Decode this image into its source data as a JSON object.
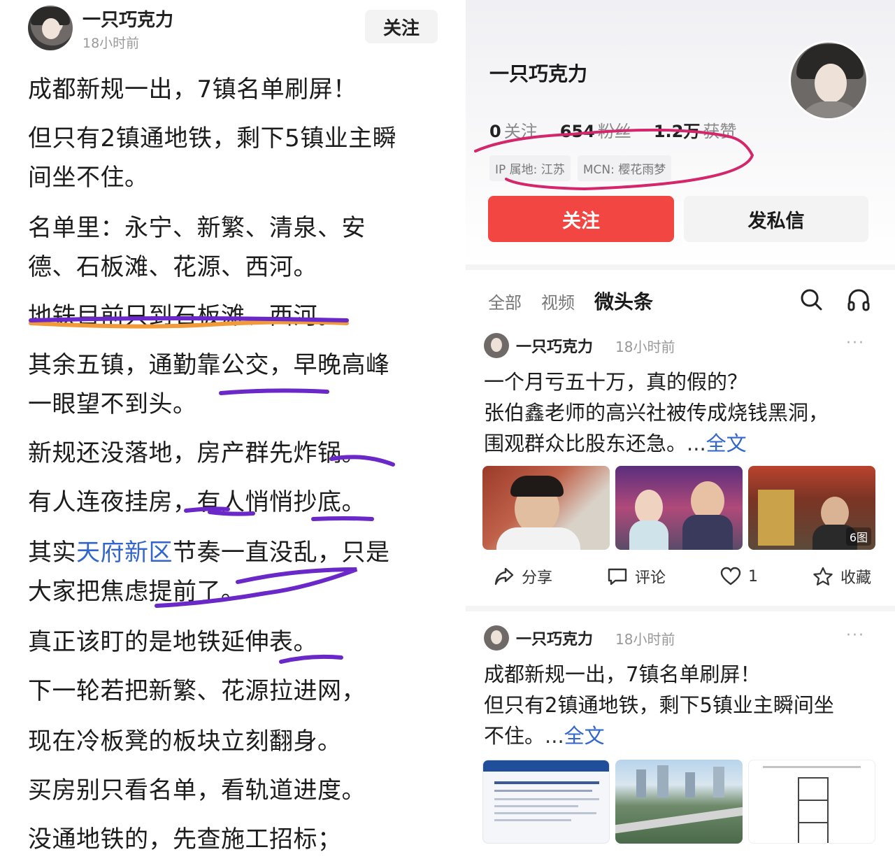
{
  "left": {
    "author": "一只巧克力",
    "time": "18小时前",
    "follow_label": "关注",
    "lines": [
      "成都新规一出，7镇名单刷屏！",
      "但只有2镇通地铁，剩下5镇业主瞬",
      "间坐不住。",
      "名单里：永宁、新繁、清泉、安",
      "德、石板滩、花源、西河。",
      "地铁目前只到石板滩、西河。",
      "其余五镇，通勤靠公交，早晚高峰",
      "一眼望不到头。",
      "新规还没落地，房产群先炸锅。",
      "有人连夜挂房，有人悄悄抄底。",
      "其实天府新区节奏一直没乱，只是",
      "大家把焦虑提前了。",
      "真正该盯的是地铁延伸表。",
      "下一轮若把新繁、花源拉进网，",
      "现在冷板凳的板块立刻翻身。",
      "买房别只看名单，看轨道进度。",
      "没通地铁的，先查施工招标；"
    ],
    "line11_pre": "其实",
    "line11_link": "天府新区",
    "line11_post": "节奏一直没乱，只是"
  },
  "right": {
    "profile_name": "一只巧克力",
    "stats": [
      {
        "num": "0",
        "label": "关注"
      },
      {
        "num": "654",
        "label": "粉丝"
      },
      {
        "num": "1.2万",
        "label": "获赞"
      }
    ],
    "tags": [
      "IP 属地: 江苏",
      "MCN: 樱花雨梦"
    ],
    "follow_btn": "关注",
    "message_btn": "发私信",
    "tabs": [
      "全部",
      "视频",
      "微头条"
    ],
    "posts": [
      {
        "author": "一只巧克力",
        "time": "18小时前",
        "more": "···",
        "line1": "一个月亏五十万，真的假的？",
        "line2": "张伯鑫老师的高兴社被传成烧钱黑洞，",
        "line3": "围观群众比股东还急。",
        "ellipsis": "...",
        "full": "全文",
        "badge": "6图",
        "share": "分享",
        "comment": "评论",
        "likes": "1",
        "collect": "收藏"
      },
      {
        "author": "一只巧克力",
        "time": "18小时前",
        "more": "···",
        "line1": "成都新规一出，7镇名单刷屏！",
        "line2": "但只有2镇通地铁，剩下5镇业主瞬间坐",
        "line3": "不住。",
        "ellipsis": "...",
        "full": "全文"
      }
    ]
  },
  "colors": {
    "accent_red": "#f24643",
    "link_blue": "#3366cc",
    "annotation_purple": "#6a28c8",
    "annotation_orange": "#f29a3a",
    "annotation_pink": "#d4266a"
  }
}
